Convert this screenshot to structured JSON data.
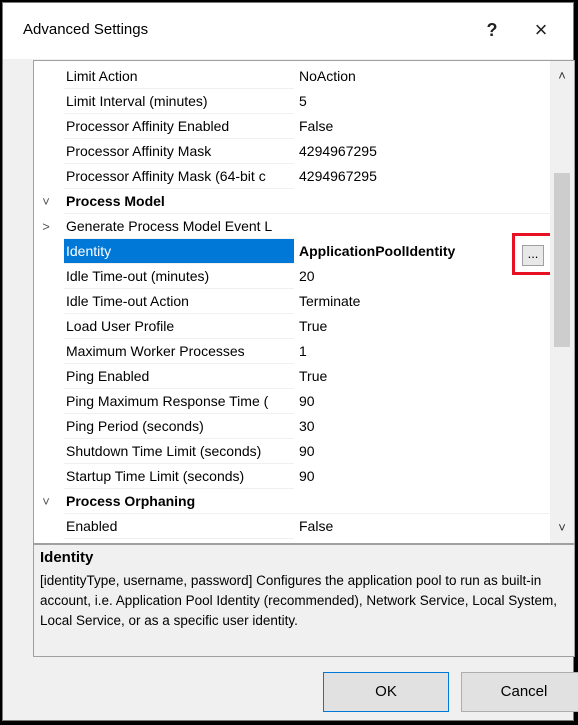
{
  "window": {
    "title": "Advanced Settings",
    "help_glyph": "?",
    "close_glyph": "×"
  },
  "grid": {
    "rows": [
      {
        "name": "Limit Action",
        "value": "NoAction"
      },
      {
        "name": "Limit Interval (minutes)",
        "value": "5"
      },
      {
        "name": "Processor Affinity Enabled",
        "value": "False"
      },
      {
        "name": "Processor Affinity Mask",
        "value": "4294967295"
      },
      {
        "name": "Processor Affinity Mask (64-bit c",
        "value": "4294967295"
      },
      {
        "category": true,
        "expander": "˅",
        "name": "Process Model"
      },
      {
        "expander": ">",
        "name": "Generate Process Model Event L",
        "value": ""
      },
      {
        "selected": true,
        "name": "Identity",
        "value": "ApplicationPoolIdentity",
        "button": "..."
      },
      {
        "name": "Idle Time-out (minutes)",
        "value": "20"
      },
      {
        "name": "Idle Time-out Action",
        "value": "Terminate"
      },
      {
        "name": "Load User Profile",
        "value": "True"
      },
      {
        "name": "Maximum Worker Processes",
        "value": "1"
      },
      {
        "name": "Ping Enabled",
        "value": "True"
      },
      {
        "name": "Ping Maximum Response Time (",
        "value": "90"
      },
      {
        "name": "Ping Period (seconds)",
        "value": "30"
      },
      {
        "name": "Shutdown Time Limit (seconds)",
        "value": "90"
      },
      {
        "name": "Startup Time Limit (seconds)",
        "value": "90"
      },
      {
        "category": true,
        "expander": "˅",
        "name": "Process Orphaning"
      },
      {
        "name": "Enabled",
        "value": "False"
      }
    ],
    "scroll_up_glyph": "˄",
    "scroll_down_glyph": "˅"
  },
  "description": {
    "title": "Identity",
    "text": "[identityType, username, password] Configures the application pool to run as built-in account, i.e. Application Pool Identity (recommended), Network Service, Local System, Local Service, or as a specific user identity."
  },
  "buttons": {
    "ok": "OK",
    "cancel": "Cancel"
  },
  "colors": {
    "selection": "#0078d7",
    "highlight_box": "#e81123"
  }
}
